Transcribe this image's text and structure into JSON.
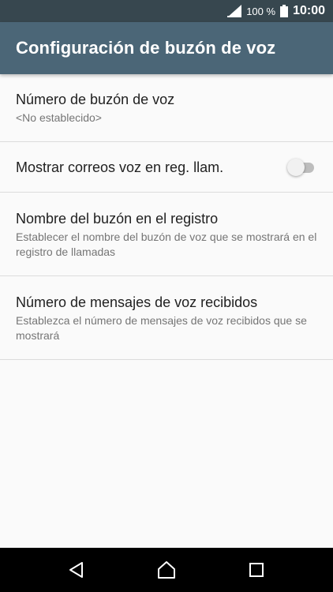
{
  "status_bar": {
    "battery_percent": "100 %",
    "time": "10:00",
    "icons": [
      "signal-icon",
      "battery-icon"
    ]
  },
  "app_bar": {
    "title": "Configuración de buzón de voz"
  },
  "preferences": [
    {
      "title": "Número de buzón de voz",
      "summary": "<No establecido>"
    },
    {
      "title": "Mostrar correos voz en reg. llam.",
      "toggle_on": false
    },
    {
      "title": "Nombre del buzón en el registro",
      "summary": "Establecer el nombre del buzón de voz que se mostrará en el registro de llamadas"
    },
    {
      "title": "Número de mensajes de voz recibidos",
      "summary": "Establezca el número de mensajes de voz recibidos que se mostrará"
    }
  ],
  "nav_bar": {
    "icons": [
      "back-icon",
      "home-icon",
      "recents-icon"
    ]
  },
  "colors": {
    "status_bar": "#37474f",
    "app_bar": "#4b6677",
    "background": "#fafafa",
    "divider": "#dcdcdc"
  }
}
